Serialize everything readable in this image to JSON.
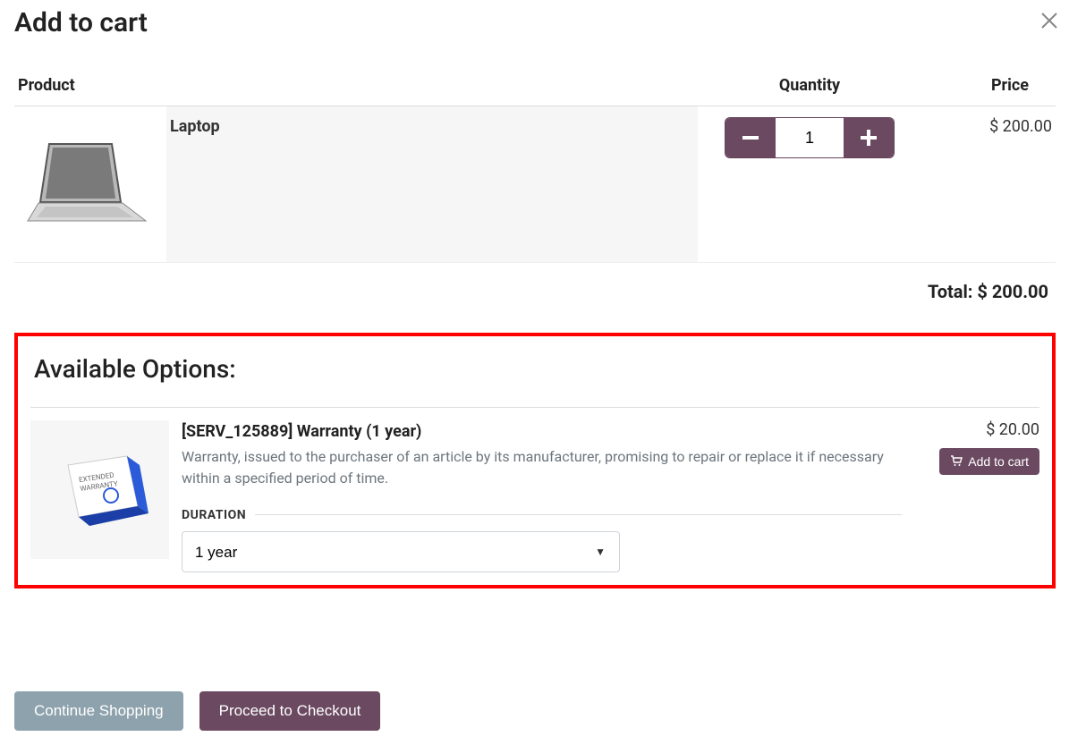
{
  "modal": {
    "title": "Add to cart"
  },
  "table": {
    "headers": {
      "product": "Product",
      "quantity": "Quantity",
      "price": "Price"
    },
    "row": {
      "name": "Laptop",
      "qty": "1",
      "price": "$ 200.00"
    }
  },
  "total": {
    "label": "Total:",
    "value": "$ 200.00"
  },
  "options": {
    "heading": "Available Options:",
    "item": {
      "name": "[SERV_125889] Warranty (1 year)",
      "description": "Warranty, issued to the purchaser of an article by its manufacturer, promising to repair or replace it if necessary within a specified period of time.",
      "duration_label": "DURATION",
      "duration_value": "1 year",
      "price": "$ 20.00",
      "add_label": "Add to cart"
    }
  },
  "footer": {
    "continue": "Continue Shopping",
    "checkout": "Proceed to Checkout"
  }
}
